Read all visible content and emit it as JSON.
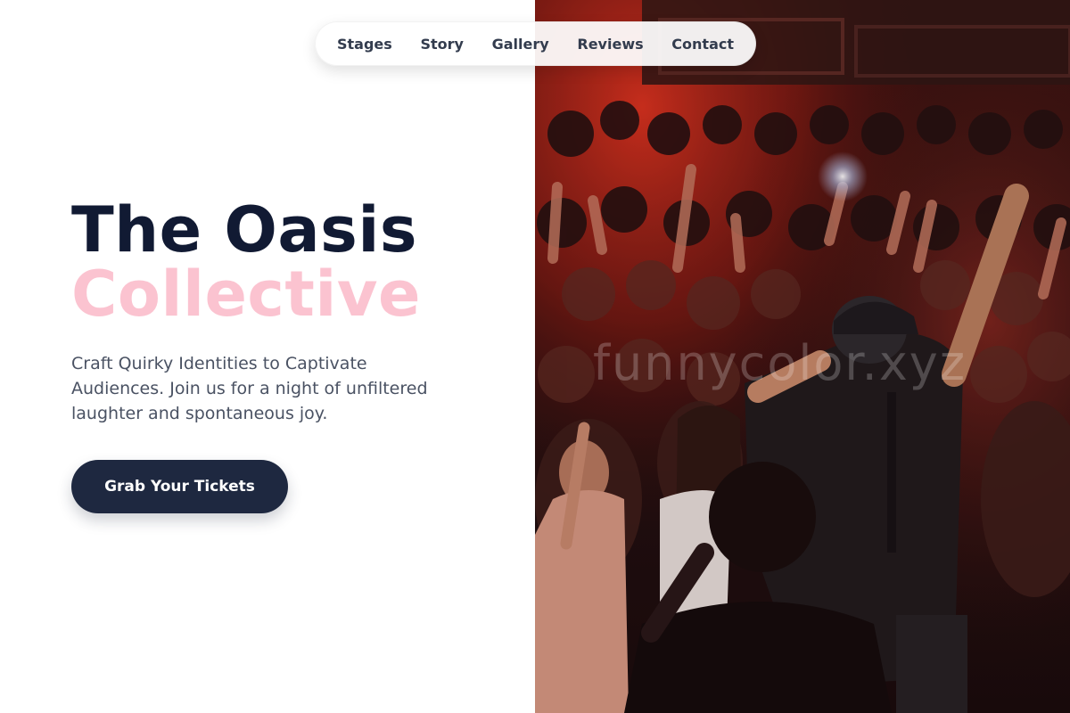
{
  "nav": {
    "items": [
      {
        "label": "Stages"
      },
      {
        "label": "Story"
      },
      {
        "label": "Gallery"
      },
      {
        "label": "Reviews"
      },
      {
        "label": "Contact"
      }
    ]
  },
  "hero": {
    "title_line1": "The Oasis",
    "title_line2": "Collective",
    "subtitle": "Craft Quirky Identities to Captivate Audiences. Join us for a night of unfiltered laughter and spontaneous joy.",
    "cta_label": "Grab Your Tickets"
  },
  "image": {
    "watermark": "funnycolor.xyz",
    "alt": "Performer on stage facing a cheering crowd under red lights"
  },
  "colors": {
    "title_dark": "#111a33",
    "title_accent": "#fbc3d0",
    "cta_bg": "#1e2840",
    "body_text": "#4a5263"
  }
}
